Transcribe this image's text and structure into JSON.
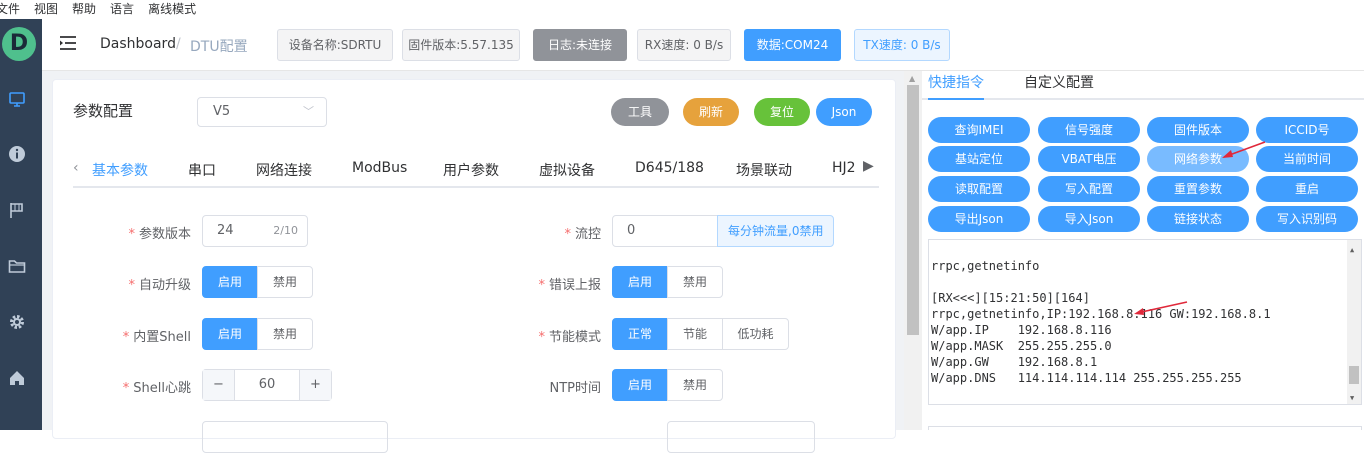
{
  "menubar": {
    "items": [
      "文件",
      "视图",
      "帮助",
      "语言",
      "离线模式"
    ]
  },
  "logo": "D",
  "header": {
    "breadcrumb_home": "Dashboard",
    "breadcrumb_sep": "/",
    "breadcrumb_current": "DTU配置",
    "device_name": "设备名称:SDRTU",
    "firmware": "固件版本:5.57.135",
    "log": "日志:未连接",
    "rx": "RX速度: 0 B/s",
    "data": "数据:COM24",
    "tx": "TX速度: 0 B/s"
  },
  "params": {
    "title": "参数配置",
    "version_select": "V5",
    "buttons": {
      "tools": "工具",
      "refresh": "刷新",
      "reset": "复位",
      "json": "Json"
    },
    "tabs": [
      "基本参数",
      "串口",
      "网络连接",
      "ModBus",
      "用户参数",
      "虚拟设备",
      "D645/188",
      "场景联动",
      "HJ2"
    ],
    "fields": {
      "param_version": {
        "label": "参数版本",
        "value": "24",
        "count": "2/10"
      },
      "flow_control": {
        "label": "流控",
        "value": "0",
        "hint": "每分钟流量,0禁用"
      },
      "auto_upgrade": {
        "label": "自动升级",
        "opts": [
          "启用",
          "禁用"
        ]
      },
      "error_report": {
        "label": "错误上报",
        "opts": [
          "启用",
          "禁用"
        ]
      },
      "builtin_shell": {
        "label": "内置Shell",
        "opts": [
          "启用",
          "禁用"
        ]
      },
      "power_mode": {
        "label": "节能模式",
        "opts": [
          "正常",
          "节能",
          "低功耗"
        ]
      },
      "shell_heartbeat": {
        "label": "Shell心跳",
        "value": "60",
        "minus": "−",
        "plus": "+"
      },
      "ntp_time": {
        "label": "NTP时间",
        "opts": [
          "启用",
          "禁用"
        ]
      }
    }
  },
  "right": {
    "tabs": [
      "快捷指令",
      "自定义配置"
    ],
    "commands": [
      "查询IMEI",
      "信号强度",
      "固件版本",
      "ICCID号",
      "基站定位",
      "VBAT电压",
      "网络参数",
      "当前时间",
      "读取配置",
      "写入配置",
      "重置参数",
      "重启",
      "导出Json",
      "导入Json",
      "链接状态",
      "写入识别码"
    ],
    "console_lines": [
      "rrpc,getnetinfo",
      "",
      "[RX<<<][15:21:50][164]",
      "rrpc,getnetinfo,IP:192.168.8.116 GW:192.168.8.1",
      "W/app.IP    192.168.8.116",
      "W/app.MASK  255.255.255.0",
      "W/app.GW    192.168.8.1",
      "W/app.DNS   114.114.114.114 255.255.255.255"
    ]
  },
  "colors": {
    "primary": "#409eff",
    "sidebar": "#304156",
    "warning": "#e6a23c",
    "success": "#67c23a",
    "info": "#909399",
    "annotation": "#e0283a"
  }
}
